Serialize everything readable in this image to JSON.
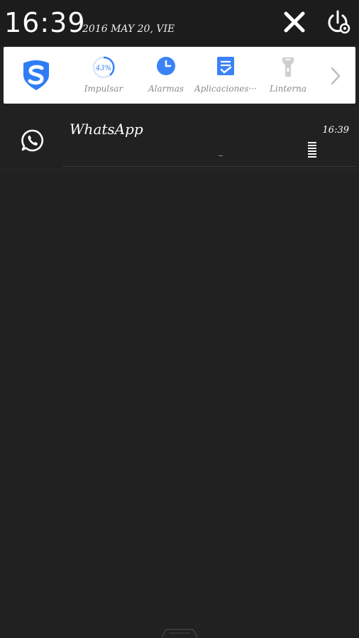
{
  "status": {
    "time": "16:39",
    "date": "2016 MAY 20, VIE",
    "close_icon": "close-icon",
    "power_icon": "power-settings-icon"
  },
  "tools": {
    "logo_icon": "security-shield-logo-icon",
    "items": [
      {
        "label": "Impulsar",
        "icon": "boost-progress-icon",
        "value": "43%"
      },
      {
        "label": "Alarmas",
        "icon": "clock-icon"
      },
      {
        "label": "Aplicaciones···",
        "icon": "checklist-icon"
      },
      {
        "label": "Linterna",
        "icon": "flashlight-icon"
      }
    ],
    "more_icon": "chevron-right-icon"
  },
  "notification": {
    "app": "WhatsApp",
    "time": "16:39",
    "icon": "whatsapp-icon"
  },
  "colors": {
    "background": "#212121",
    "accent_blue": "#3b82f6",
    "panel": "#ffffff"
  }
}
